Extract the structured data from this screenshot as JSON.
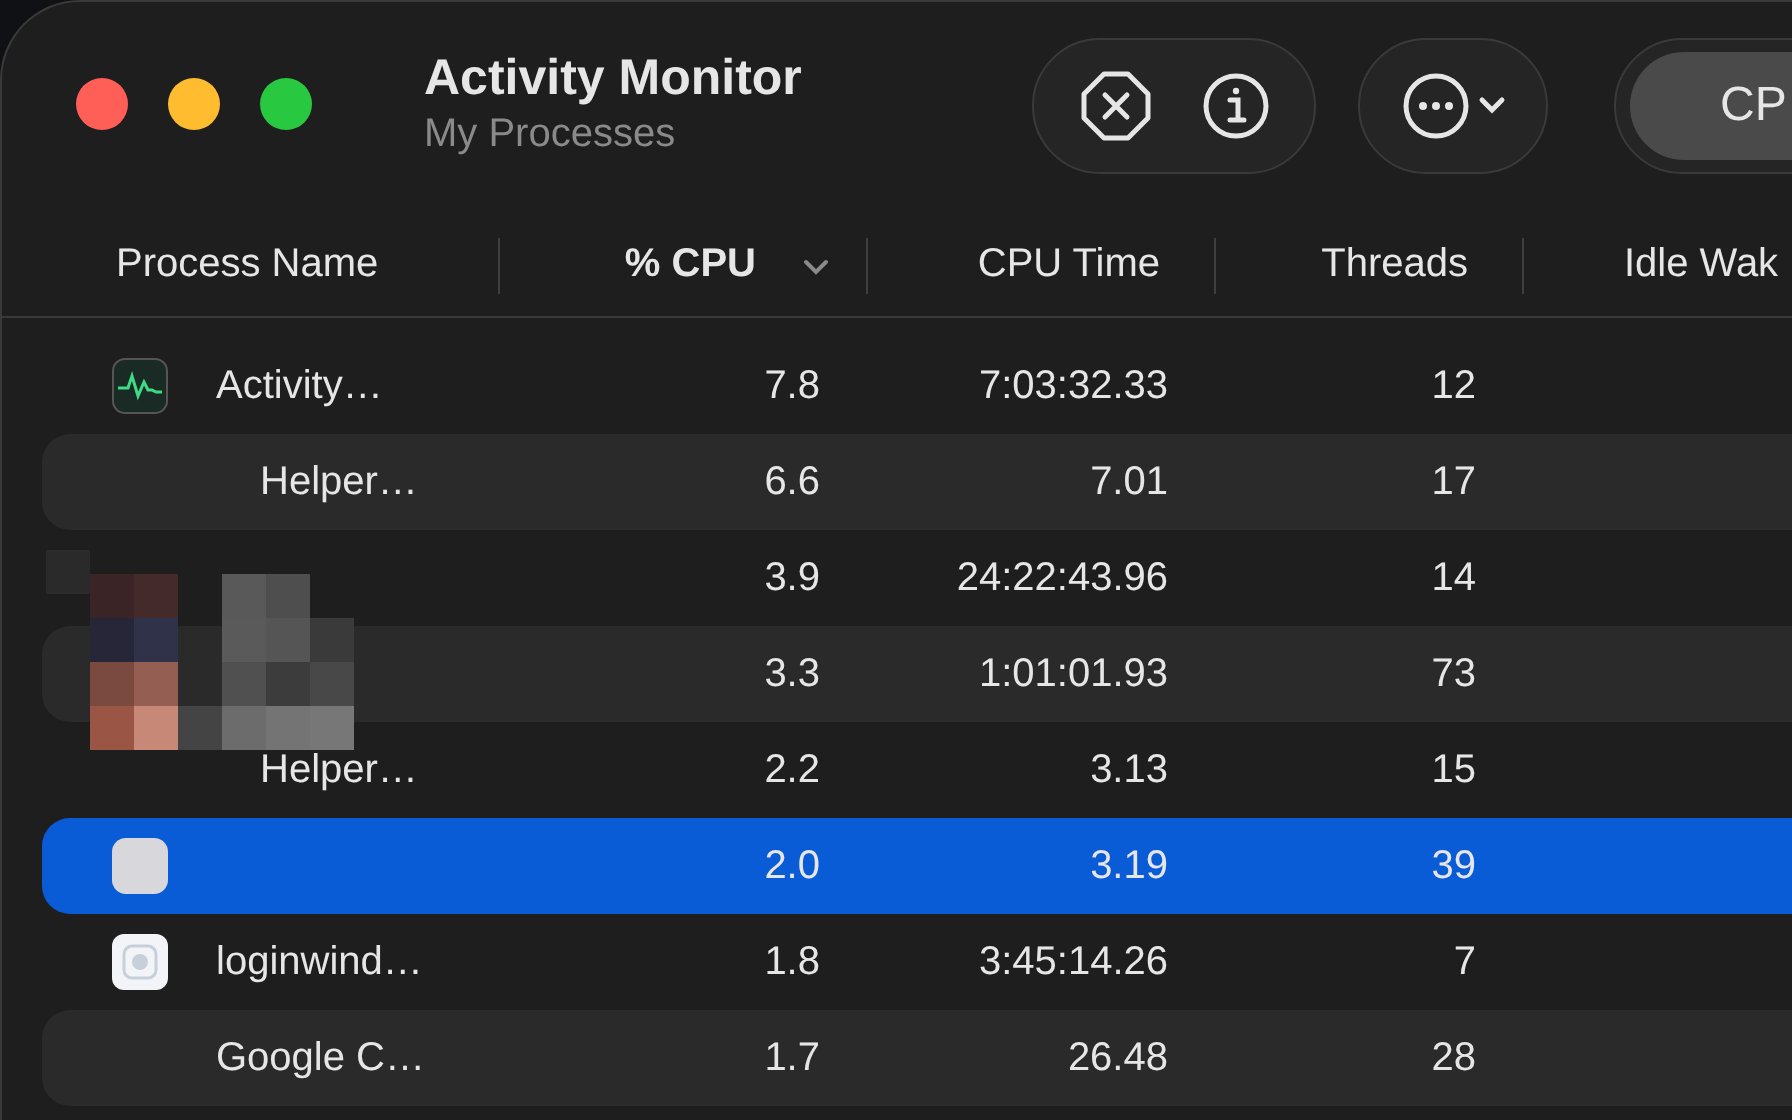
{
  "window": {
    "title": "Activity Monitor",
    "subtitle": "My Processes"
  },
  "toolbar": {
    "segment_label": "CP"
  },
  "columns": [
    {
      "label": "Process Name",
      "sorted": false
    },
    {
      "label": "% CPU",
      "sorted": true
    },
    {
      "label": "CPU Time",
      "sorted": false
    },
    {
      "label": "Threads",
      "sorted": false
    },
    {
      "label": "Idle Wak",
      "sorted": false
    }
  ],
  "rows": [
    {
      "kind": "monitor",
      "name": "Activity…",
      "cpu": "7.8",
      "cpu_time": "7:03:32.33",
      "threads": "12",
      "selected": false,
      "children": [
        {
          "name": "Helper…",
          "cpu": "6.6",
          "cpu_time": "7.01",
          "threads": "17",
          "selected": false
        }
      ]
    },
    {
      "kind": "redacted",
      "cpu": "3.9",
      "cpu_time": "24:22:43.96",
      "threads": "14",
      "selected": false
    },
    {
      "kind": "redacted",
      "cpu": "3.3",
      "cpu_time": "1:01:01.93",
      "threads": "73",
      "selected": false,
      "children": [
        {
          "name": "Helper…",
          "cpu": "2.2",
          "cpu_time": "3.13",
          "threads": "15",
          "selected": false
        }
      ]
    },
    {
      "kind": "blank",
      "cpu": "2.0",
      "cpu_time": "3.19",
      "threads": "39",
      "selected": true
    },
    {
      "kind": "login",
      "name": "loginwind…",
      "cpu": "1.8",
      "cpu_time": "3:45:14.26",
      "threads": "7",
      "selected": false
    },
    {
      "name": "Google C…",
      "cpu": "1.7",
      "cpu_time": "26.48",
      "threads": "28",
      "selected": false
    }
  ]
}
